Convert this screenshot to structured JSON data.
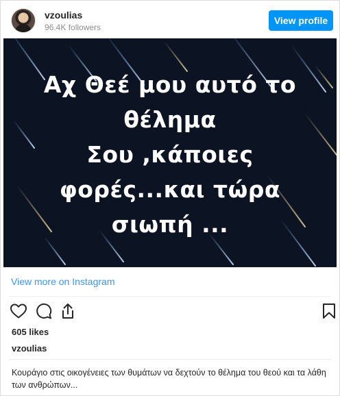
{
  "header": {
    "username": "vzoulias",
    "followers": "96.4K followers",
    "view_profile_label": "View profile"
  },
  "post": {
    "quote_lines": [
      "Αχ Θεέ μου αυτό το",
      "θέλημα",
      "Σου ,κάποιες",
      "φορές...και τώρα",
      "σιωπή ..."
    ],
    "view_more_label": "View more on Instagram"
  },
  "actions": {
    "icons": [
      "heart-icon",
      "comment-icon",
      "share-icon",
      "bookmark-icon"
    ]
  },
  "likes": "605 likes",
  "caption": {
    "username": "vzoulias",
    "text": "Κουράγιο στις οικογένειες των θυμάτων να δεχτούν το θέλημα του θεού και τα λάθη των ανθρώπων..."
  },
  "colors": {
    "brand_blue": "#0095f6",
    "link_blue": "#3897f0",
    "image_bg": "#0c1424"
  }
}
